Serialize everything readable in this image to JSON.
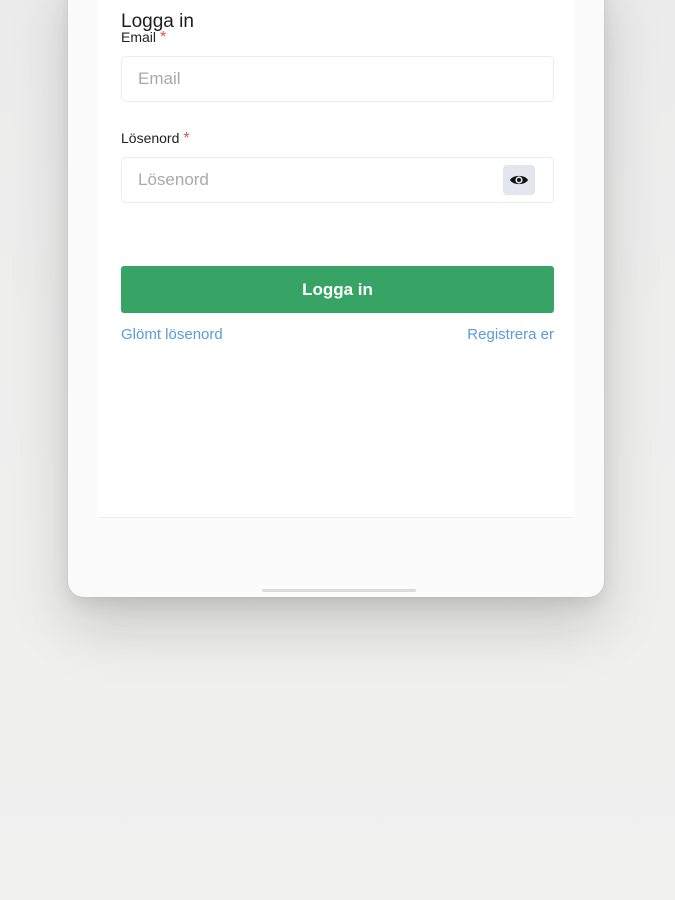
{
  "login": {
    "title": "Logga in",
    "email": {
      "label": "Email",
      "required_mark": "*",
      "placeholder": "Email",
      "value": ""
    },
    "password": {
      "label": "Lösenord",
      "required_mark": "*",
      "placeholder": "Lösenord",
      "value": "",
      "toggle_icon": "eye-icon"
    },
    "submit_label": "Logga in",
    "forgot_password_link": "Glömt lösenord",
    "register_link": "Registrera er"
  },
  "colors": {
    "primary_button": "#37a466",
    "link": "#5b9bd9",
    "required": "#e05252"
  }
}
